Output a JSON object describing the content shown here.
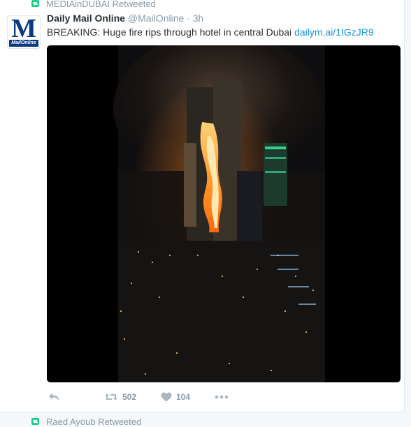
{
  "retweet_banner_top": {
    "text": "MEDIAinDUBAI Retweeted"
  },
  "tweet": {
    "author_name": "Daily Mail Online",
    "handle": "@MailOnline",
    "separator": "·",
    "time": "3h",
    "avatar_logo_letter": "M",
    "avatar_logo_text": "MailOnline",
    "text": "BREAKING: Huge fire rips through hotel in central Dubai ",
    "link_text": "dailym.ai/1IGzJR9",
    "media_icon": "photo-of-burning-tower-at-night",
    "actions": {
      "reply_icon": "reply-icon",
      "retweet_icon": "retweet-icon",
      "retweet_count": "502",
      "like_icon": "heart-icon",
      "like_count": "104",
      "more_icon": "more-dots-icon"
    }
  },
  "retweet_banner_bottom": {
    "text": "Raed Ayoub Retweeted"
  },
  "colors": {
    "retweet_green": "#19cf86",
    "link_blue": "#1b95e0",
    "muted_gray": "#8899a6",
    "action_gray": "#aab8c2",
    "logo_blue": "#0a3a84"
  }
}
